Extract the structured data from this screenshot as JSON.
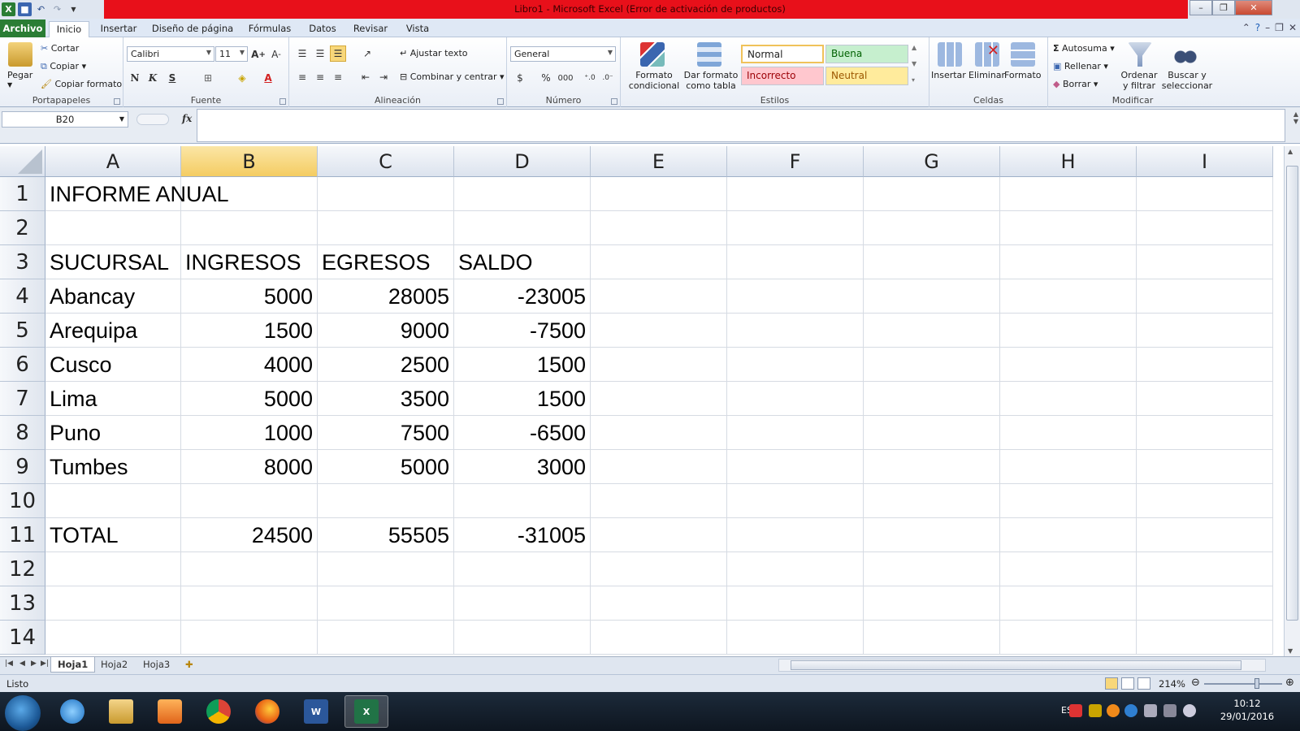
{
  "window": {
    "title": "Libro1  -  Microsoft Excel (Error de activación de productos)"
  },
  "tabs": {
    "archivo": "Archivo",
    "items": [
      "Inicio",
      "Insertar",
      "Diseño de página",
      "Fórmulas",
      "Datos",
      "Revisar",
      "Vista"
    ]
  },
  "ribbon": {
    "clipboard": {
      "paste": "Pegar",
      "cut": "Cortar",
      "copy": "Copiar",
      "format_painter": "Copiar formato",
      "label": "Portapapeles"
    },
    "font": {
      "name": "Calibri",
      "size": "11",
      "bold": "N",
      "italic": "K",
      "underline": "S",
      "label": "Fuente"
    },
    "alignment": {
      "wrap": "Ajustar texto",
      "merge": "Combinar y centrar",
      "label": "Alineación"
    },
    "number": {
      "format": "General",
      "currency": "$",
      "percent": "%",
      "thousands": "000",
      "label": "Número"
    },
    "styles": {
      "cond_format_1": "Formato",
      "cond_format_2": "condicional",
      "as_table_1": "Dar formato",
      "as_table_2": "como tabla",
      "normal": "Normal",
      "good": "Buena",
      "bad": "Incorrecto",
      "neutral": "Neutral",
      "label": "Estilos"
    },
    "cells": {
      "insert": "Insertar",
      "delete": "Eliminar",
      "format": "Formato",
      "label": "Celdas"
    },
    "editing": {
      "autosum": "Autosuma",
      "fill": "Rellenar",
      "clear": "Borrar",
      "sort_1": "Ordenar",
      "sort_2": "y filtrar",
      "find_1": "Buscar y",
      "find_2": "seleccionar",
      "label": "Modificar"
    }
  },
  "formula_bar": {
    "name_box": "B20",
    "fx": "fx",
    "value": ""
  },
  "grid": {
    "columns": [
      "A",
      "B",
      "C",
      "D",
      "E",
      "F",
      "G",
      "H",
      "I"
    ],
    "selected_column": "B",
    "rows": [
      "1",
      "2",
      "3",
      "4",
      "5",
      "6",
      "7",
      "8",
      "9",
      "10",
      "11",
      "12",
      "13",
      "14"
    ],
    "cells": [
      [
        "INFORME ANUAL",
        "",
        "",
        ""
      ],
      [
        "",
        "",
        "",
        ""
      ],
      [
        "SUCURSAL",
        "INGRESOS",
        "EGRESOS",
        "SALDO"
      ],
      [
        "Abancay",
        "5000",
        "28005",
        "-23005"
      ],
      [
        "Arequipa",
        "1500",
        "9000",
        "-7500"
      ],
      [
        "Cusco",
        "4000",
        "2500",
        "1500"
      ],
      [
        "Lima",
        "5000",
        "3500",
        "1500"
      ],
      [
        "Puno",
        "1000",
        "7500",
        "-6500"
      ],
      [
        "Tumbes",
        "8000",
        "5000",
        "3000"
      ],
      [
        "",
        "",
        "",
        ""
      ],
      [
        "TOTAL",
        "24500",
        "55505",
        "-31005"
      ],
      [
        "",
        "",
        "",
        ""
      ],
      [
        "",
        "",
        "",
        ""
      ],
      [
        "",
        "",
        "",
        ""
      ]
    ]
  },
  "sheets": [
    "Hoja1",
    "Hoja2",
    "Hoja3"
  ],
  "status": {
    "ready": "Listo",
    "zoom": "214%"
  },
  "taskbar": {
    "lang": "ES",
    "time": "10:12",
    "date": "29/01/2016"
  },
  "colors": {
    "excel_green": "#2a7d34",
    "title_red": "#e8101a",
    "selected_header": "#f4cc62"
  }
}
